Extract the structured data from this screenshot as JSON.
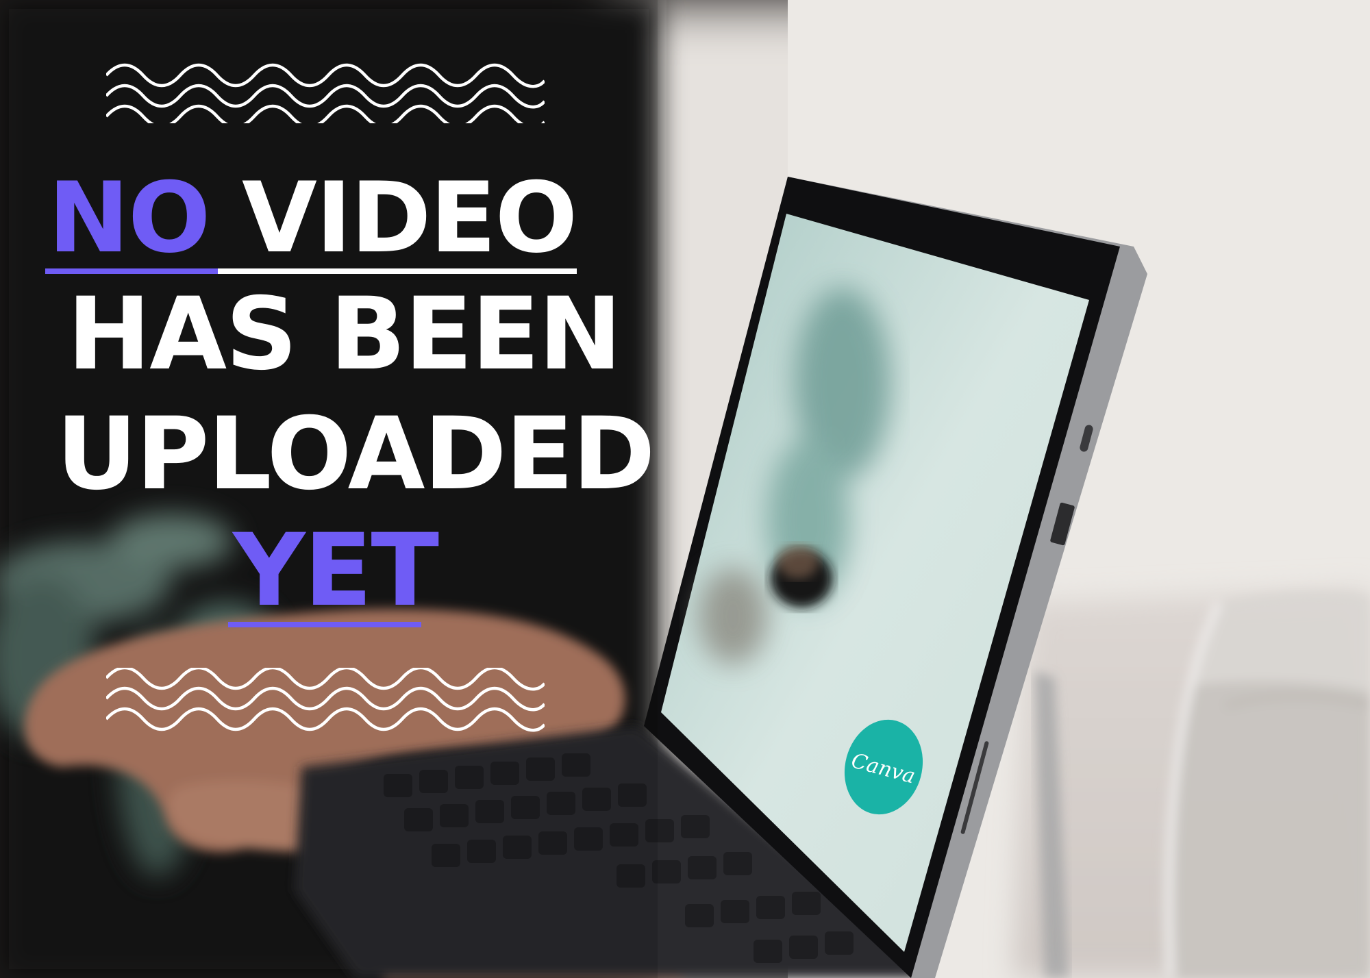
{
  "headline": {
    "line1_accent": "NO",
    "line1_rest": "VIDEO",
    "line2": "HAS BEEN",
    "line3": "UPLOADED",
    "line4_accent": "YET"
  },
  "colors": {
    "accent": "#6f5cf5",
    "text": "#ffffff",
    "screen_logo": "#1ab3a6"
  },
  "screen_logo_text": "Canva"
}
